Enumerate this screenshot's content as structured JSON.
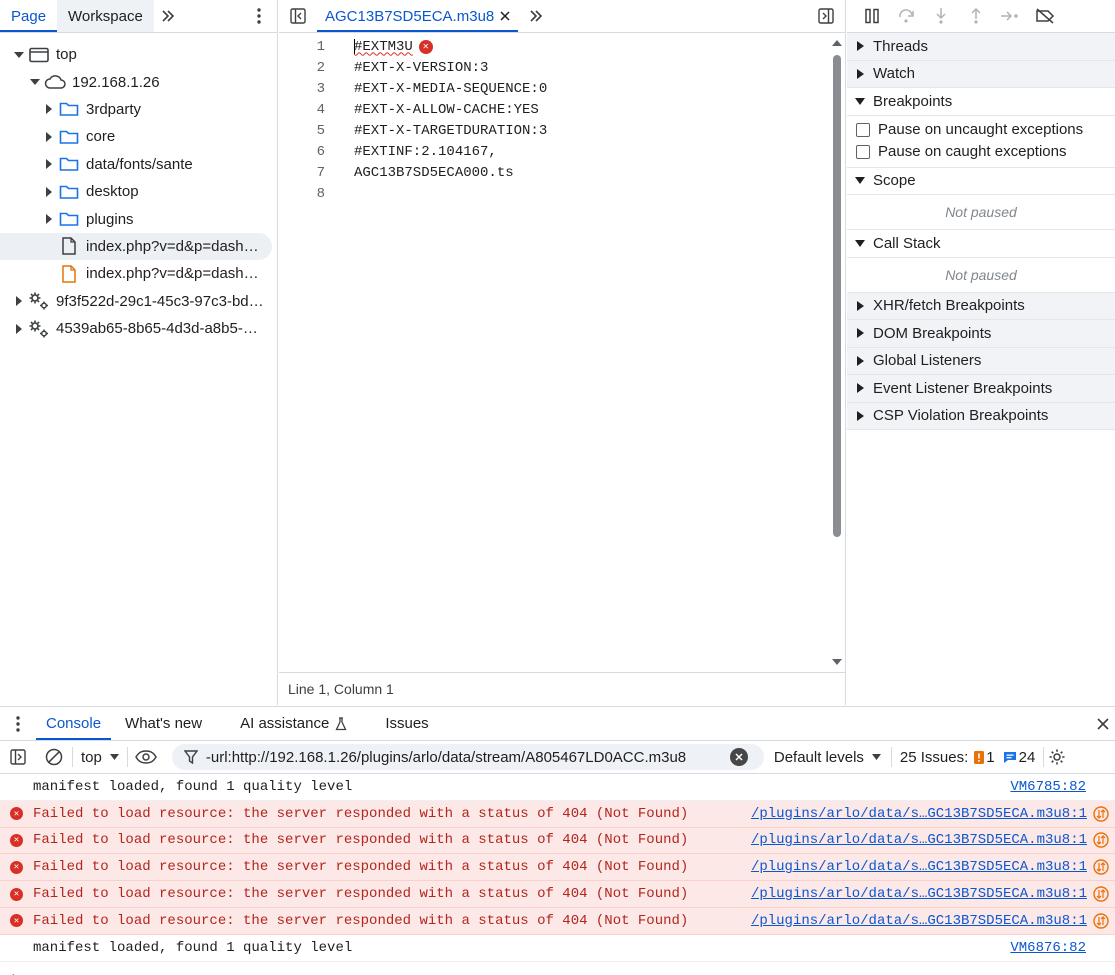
{
  "navigator": {
    "tabs": [
      {
        "label": "Page"
      },
      {
        "label": "Workspace"
      }
    ],
    "more_tabs_icon": "chevron-double-right",
    "menu_icon": "kebab",
    "tree": [
      {
        "label": "top",
        "icon": "frame",
        "caret": "open",
        "depth": 0
      },
      {
        "label": "192.168.1.26",
        "icon": "cloud",
        "caret": "open",
        "depth": 1
      },
      {
        "label": "3rdparty",
        "icon": "folder",
        "caret": "closed",
        "depth": 2
      },
      {
        "label": "core",
        "icon": "folder",
        "caret": "closed",
        "depth": 2
      },
      {
        "label": "data/fonts/sante",
        "icon": "folder",
        "caret": "closed",
        "depth": 2
      },
      {
        "label": "desktop",
        "icon": "folder",
        "caret": "closed",
        "depth": 2
      },
      {
        "label": "plugins",
        "icon": "folder",
        "caret": "closed",
        "depth": 2
      },
      {
        "label": "index.php?v=d&p=dash…",
        "icon": "file",
        "caret": "none",
        "depth": 2,
        "selected": true
      },
      {
        "label": "index.php?v=d&p=dash…",
        "icon": "file-orange",
        "caret": "none",
        "depth": 2
      },
      {
        "label": "9f3f522d-29c1-45c3-97c3-bd…",
        "icon": "gears",
        "caret": "closed",
        "depth": 0
      },
      {
        "label": "4539ab65-8b65-4d3d-a8b5-…",
        "icon": "gears",
        "caret": "closed",
        "depth": 0
      }
    ]
  },
  "editor": {
    "file_tab": "AGC13B7SD5ECA.m3u8",
    "lines": [
      {
        "n": "1",
        "text": "#EXTM3U",
        "error": true
      },
      {
        "n": "2",
        "text": "#EXT-X-VERSION:3"
      },
      {
        "n": "3",
        "text": "#EXT-X-MEDIA-SEQUENCE:0"
      },
      {
        "n": "4",
        "text": "#EXT-X-ALLOW-CACHE:YES"
      },
      {
        "n": "5",
        "text": "#EXT-X-TARGETDURATION:3"
      },
      {
        "n": "6",
        "text": "#EXTINF:2.104167,"
      },
      {
        "n": "7",
        "text": "AGC13B7SD5ECA000.ts"
      },
      {
        "n": "8",
        "text": ""
      }
    ],
    "status": "Line 1, Column 1"
  },
  "debugger": {
    "sections": [
      {
        "label": "Threads",
        "open": false
      },
      {
        "label": "Watch",
        "open": false
      },
      {
        "label": "Breakpoints",
        "open": true
      }
    ],
    "checks": [
      {
        "label": "Pause on uncaught exceptions"
      },
      {
        "label": "Pause on caught exceptions"
      }
    ],
    "scope": {
      "label": "Scope",
      "empty": "Not paused"
    },
    "callstack": {
      "label": "Call Stack",
      "empty": "Not paused"
    },
    "more_sections": [
      {
        "label": "XHR/fetch Breakpoints"
      },
      {
        "label": "DOM Breakpoints"
      },
      {
        "label": "Global Listeners"
      },
      {
        "label": "Event Listener Breakpoints"
      },
      {
        "label": "CSP Violation Breakpoints"
      }
    ]
  },
  "drawer": {
    "tabs": [
      {
        "label": "Console"
      },
      {
        "label": "What's new"
      },
      {
        "label": "AI assistance"
      },
      {
        "label": "Issues"
      }
    ],
    "context": "top",
    "filter": "-url:http://192.168.1.26/plugins/arlo/data/stream/A805467LD0ACC.m3u8",
    "levels": "Default levels",
    "issues_label": "25 Issues:",
    "issues_warn": "1",
    "issues_info": "24",
    "messages": [
      {
        "type": "info",
        "text": "manifest loaded, found 1 quality level",
        "source": "VM6785:82"
      },
      {
        "type": "error",
        "text": "Failed to load resource: the server responded with a status of 404 (Not Found)",
        "source": "/plugins/arlo/data/s…GC13B7SD5ECA.m3u8:1"
      },
      {
        "type": "error",
        "text": "Failed to load resource: the server responded with a status of 404 (Not Found)",
        "source": "/plugins/arlo/data/s…GC13B7SD5ECA.m3u8:1"
      },
      {
        "type": "error",
        "text": "Failed to load resource: the server responded with a status of 404 (Not Found)",
        "source": "/plugins/arlo/data/s…GC13B7SD5ECA.m3u8:1"
      },
      {
        "type": "error",
        "text": "Failed to load resource: the server responded with a status of 404 (Not Found)",
        "source": "/plugins/arlo/data/s…GC13B7SD5ECA.m3u8:1"
      },
      {
        "type": "error",
        "text": "Failed to load resource: the server responded with a status of 404 (Not Found)",
        "source": "/plugins/arlo/data/s…GC13B7SD5ECA.m3u8:1"
      },
      {
        "type": "info",
        "text": "manifest loaded, found 1 quality level",
        "source": "VM6876:82"
      }
    ]
  },
  "colors": {
    "accent": "#0b57d0",
    "error": "#d93025",
    "error_bg": "#fce8e6",
    "file_orange": "#e8710a"
  }
}
